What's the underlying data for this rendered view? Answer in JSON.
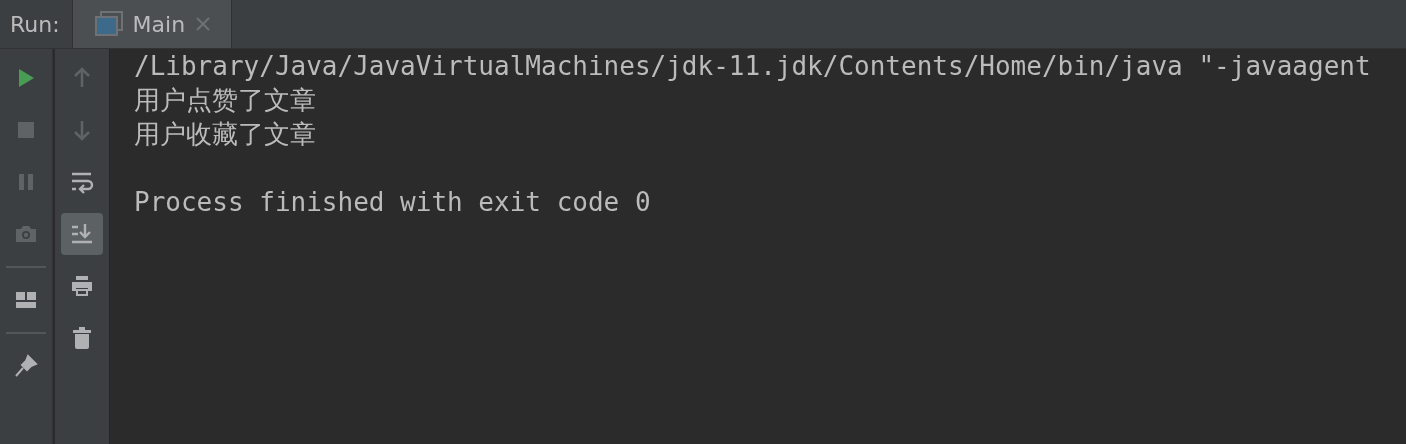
{
  "run_panel": {
    "label": "Run:",
    "tabs": [
      {
        "label": "Main",
        "selected": true
      }
    ]
  },
  "left_toolbar": [
    {
      "kind": "run",
      "disabled": false
    },
    {
      "kind": "stop",
      "disabled": true
    },
    {
      "kind": "pause",
      "disabled": true
    },
    {
      "kind": "camera",
      "disabled": true
    },
    {
      "kind": "separator"
    },
    {
      "kind": "layout",
      "disabled": false
    },
    {
      "kind": "separator"
    },
    {
      "kind": "pin",
      "disabled": false
    }
  ],
  "right_toolbar": [
    {
      "kind": "up",
      "disabled": true,
      "on": false
    },
    {
      "kind": "down",
      "disabled": true,
      "on": false
    },
    {
      "kind": "wrap",
      "disabled": false,
      "on": false
    },
    {
      "kind": "scroll-end",
      "disabled": false,
      "on": true
    },
    {
      "kind": "print",
      "disabled": false,
      "on": false
    },
    {
      "kind": "trash",
      "disabled": false,
      "on": false
    }
  ],
  "console": {
    "lines": [
      "/Library/Java/JavaVirtualMachines/jdk-11.jdk/Contents/Home/bin/java \"-javaagent",
      "用户点赞了文章",
      "用户收藏了文章"
    ],
    "exit_message": "Process finished with exit code 0"
  }
}
